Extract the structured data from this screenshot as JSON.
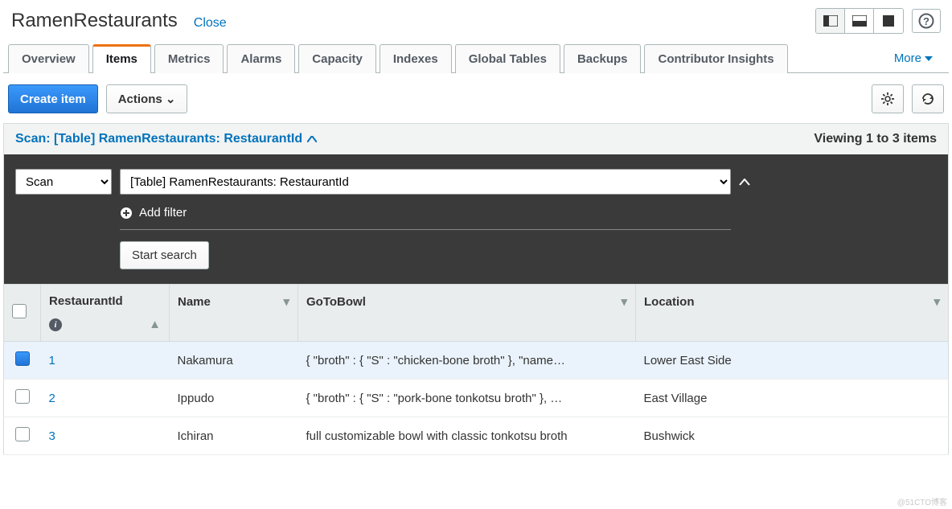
{
  "header": {
    "table_name": "RamenRestaurants",
    "close": "Close",
    "help_symbol": "?"
  },
  "tabs": {
    "items": [
      "Overview",
      "Items",
      "Metrics",
      "Alarms",
      "Capacity",
      "Indexes",
      "Global Tables",
      "Backups",
      "Contributor Insights"
    ],
    "active_index": 1,
    "more": "More"
  },
  "toolbar": {
    "create_item": "Create item",
    "actions": "Actions"
  },
  "scan": {
    "title": "Scan: [Table] RamenRestaurants: RestaurantId",
    "viewing": "Viewing 1 to 3 items",
    "mode_select": "Scan",
    "target_select": "[Table] RamenRestaurants: RestaurantId",
    "add_filter": "Add filter",
    "start_search": "Start search"
  },
  "columns": {
    "id": "RestaurantId",
    "name": "Name",
    "bowl": "GoToBowl",
    "location": "Location"
  },
  "rows": [
    {
      "selected": true,
      "id": "1",
      "name": "Nakamura",
      "bowl": "{ \"broth\" : { \"S\" : \"chicken-bone broth\" }, \"name…",
      "location": "Lower East Side"
    },
    {
      "selected": false,
      "id": "2",
      "name": "Ippudo",
      "bowl": "{ \"broth\" : { \"S\" : \"pork-bone tonkotsu broth\" }, …",
      "location": "East Village"
    },
    {
      "selected": false,
      "id": "3",
      "name": "Ichiran",
      "bowl": "full customizable bowl with classic tonkotsu broth",
      "location": "Bushwick"
    }
  ],
  "watermark": "@51CTO博客"
}
